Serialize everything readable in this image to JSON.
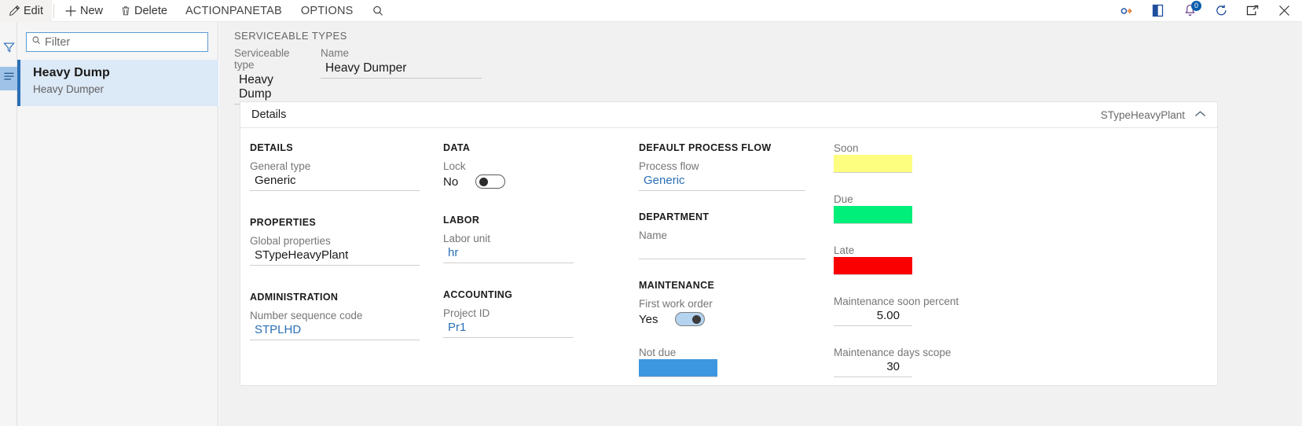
{
  "actionpane": {
    "buttons": [
      {
        "label": "Edit",
        "icon": "pencil-icon"
      },
      {
        "label": "New",
        "icon": "plus-icon"
      },
      {
        "label": "Delete",
        "icon": "trash-icon"
      }
    ],
    "tabs": [
      {
        "label": "ACTIONPANETAB"
      },
      {
        "label": "OPTIONS"
      }
    ],
    "search_icon": "search-icon",
    "right_icons": [
      {
        "name": "link-icon"
      },
      {
        "name": "book-icon"
      },
      {
        "name": "notifications-icon",
        "badge": "0"
      },
      {
        "name": "refresh-icon"
      },
      {
        "name": "popout-icon"
      },
      {
        "name": "close-icon"
      }
    ]
  },
  "leftrail": {
    "filter_icon": "funnel-icon",
    "list_icon": "list-lines-icon"
  },
  "listpane": {
    "filter": {
      "placeholder": "Filter",
      "value": "",
      "icon": "search-icon"
    },
    "items": [
      {
        "title": "Heavy Dump",
        "subtitle": "Heavy Dumper"
      }
    ]
  },
  "header": {
    "caption": "SERVICEABLE TYPES",
    "fields": [
      {
        "label": "Serviceable type",
        "value": "Heavy Dump"
      },
      {
        "label": "Name",
        "value": "Heavy Dumper"
      }
    ]
  },
  "details_card": {
    "title": "Details",
    "tag": "STypeHeavyPlant",
    "collapse_icon": "chevron-up-icon",
    "groups": {
      "details": {
        "title": "DETAILS",
        "general_type": {
          "label": "General type",
          "value": "Generic"
        }
      },
      "properties": {
        "title": "PROPERTIES",
        "global_properties": {
          "label": "Global properties",
          "value": "STypeHeavyPlant"
        }
      },
      "administration": {
        "title": "ADMINISTRATION",
        "number_sequence_code": {
          "label": "Number sequence code",
          "value": "STPLHD"
        }
      },
      "data": {
        "title": "DATA",
        "lock": {
          "label": "Lock",
          "value": "No",
          "state": "off"
        }
      },
      "labor": {
        "title": "LABOR",
        "labor_unit": {
          "label": "Labor unit",
          "value": "hr"
        }
      },
      "accounting": {
        "title": "ACCOUNTING",
        "project_id": {
          "label": "Project ID",
          "value": "Pr1"
        }
      },
      "default_process_flow": {
        "title": "DEFAULT PROCESS FLOW",
        "process_flow": {
          "label": "Process flow",
          "value": "Generic"
        }
      },
      "department": {
        "title": "DEPARTMENT",
        "name": {
          "label": "Name",
          "value": ""
        }
      },
      "maintenance": {
        "title": "MAINTENANCE",
        "first_work_order": {
          "label": "First work order",
          "value": "Yes",
          "state": "on"
        },
        "not_due": {
          "label": "Not due",
          "color": "#3d97e0"
        }
      },
      "status_colors": {
        "soon": {
          "label": "Soon",
          "color": "#fdfd7f"
        },
        "due": {
          "label": "Due",
          "color": "#00ee7a"
        },
        "late": {
          "label": "Late",
          "color": "#fa0000"
        },
        "maintenance_soon_percent": {
          "label": "Maintenance soon percent",
          "value": "5.00"
        },
        "maintenance_days_scope": {
          "label": "Maintenance days scope",
          "value": "30"
        }
      }
    }
  }
}
